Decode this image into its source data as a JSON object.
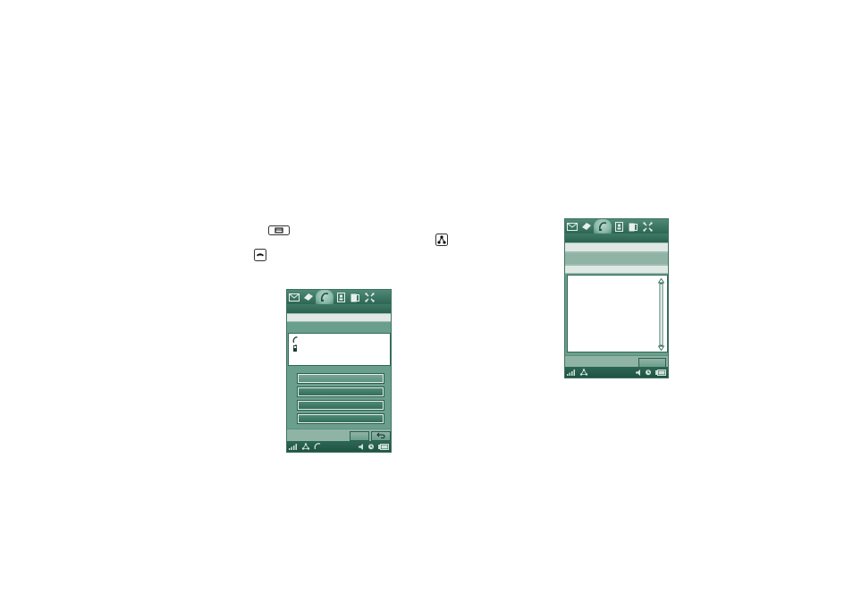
{
  "icons": {
    "floating": [
      "keyboard-key-icon",
      "hangup-key-icon",
      "network-icon"
    ],
    "tabs": [
      "messaging-icon",
      "web-icon",
      "phone-icon",
      "contacts-icon",
      "calendar-icon",
      "applications-icon"
    ],
    "status_a": [
      "signal-strength-icon",
      "network-icon",
      "call-active-icon",
      "volume-icon",
      "alarm-clock-icon",
      "battery-icon"
    ],
    "status_b": [
      "signal-strength-icon",
      "network-icon",
      "volume-icon",
      "alarm-clock-icon",
      "battery-icon"
    ],
    "list_a": [
      "phone-icon",
      "mobile-phone-icon"
    ],
    "back": "back-arrow-icon"
  },
  "colors": {
    "screen_bg": "#6b9f8d",
    "bar_dark": "#2d6654",
    "band_light": "#dfe8e4"
  }
}
